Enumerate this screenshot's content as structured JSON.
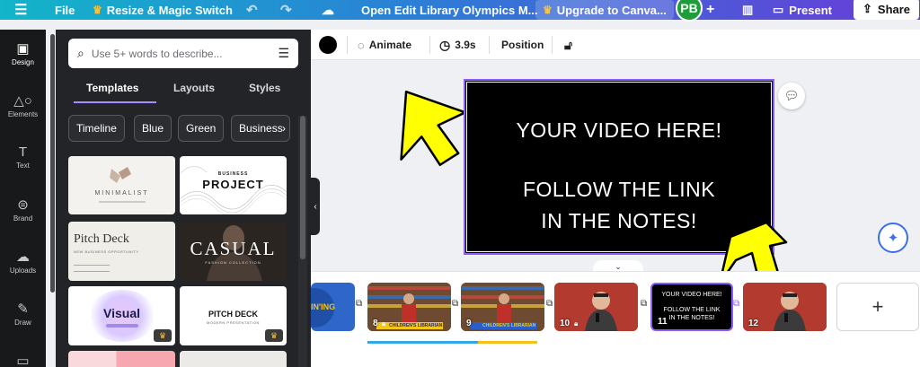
{
  "topbar": {
    "menu_icon": "hamburger-icon",
    "file": "File",
    "resize": "Resize & Magic Switch",
    "doc_title": "Open Edit Library Olympics M...",
    "upgrade": "Upgrade to Canva...",
    "avatar_initials": "PB",
    "present": "Present",
    "share": "Share"
  },
  "rail": [
    {
      "label": "Design",
      "icon": "design-icon"
    },
    {
      "label": "Elements",
      "icon": "elements-icon"
    },
    {
      "label": "Text",
      "icon": "text-icon"
    },
    {
      "label": "Brand",
      "icon": "brand-icon"
    },
    {
      "label": "Uploads",
      "icon": "uploads-icon"
    },
    {
      "label": "Draw",
      "icon": "draw-icon"
    }
  ],
  "panel": {
    "search_placeholder": "Use 5+ words to describe...",
    "tabs": [
      "Templates",
      "Layouts",
      "Styles"
    ],
    "active_tab": "Templates",
    "chips": [
      "Timeline",
      "Blue",
      "Green",
      "Business"
    ],
    "templates": [
      {
        "title": "MINIMALIST"
      },
      {
        "title": "PROJECT",
        "eyebrow": "BUSINESS"
      },
      {
        "title": "Pitch Deck",
        "subtitle": "NEW BUSINESS OPPORTUNITY"
      },
      {
        "title": "CASUAL",
        "subtitle": "FASHION COLLECTION"
      },
      {
        "title": "Visual"
      },
      {
        "title": "PITCH DECK",
        "subtitle": "MODERN PRESENTATION"
      }
    ]
  },
  "editbar": {
    "color": "#000000",
    "animate": "Animate",
    "duration": "3.9s",
    "position": "Position"
  },
  "slide": {
    "line1": "YOUR VIDEO HERE!",
    "line2": "FOLLOW THE LINK",
    "line3": "IN THE NOTES!"
  },
  "filmstrip": {
    "frames": [
      {
        "num": "",
        "kind": "blue-logo",
        "label": "IN'ING"
      },
      {
        "num": "8",
        "kind": "library",
        "label": "CHILDREN'S LIBRARIAN"
      },
      {
        "num": "9",
        "kind": "library",
        "label": "CHILDREN'S LIBRARIAN"
      },
      {
        "num": "10",
        "kind": "red-portrait"
      },
      {
        "num": "11",
        "kind": "text",
        "line1": "YOUR VIDEO HERE!",
        "line2": "FOLLOW THE LINK",
        "line3": "IN THE NOTES!"
      },
      {
        "num": "12",
        "kind": "red-portrait"
      }
    ],
    "add_label": "+"
  },
  "colors": {
    "accent": "#8b5cf6",
    "arrow_yellow": "#ffff00",
    "rail_bg": "#18191b",
    "panel_bg": "#232427"
  }
}
